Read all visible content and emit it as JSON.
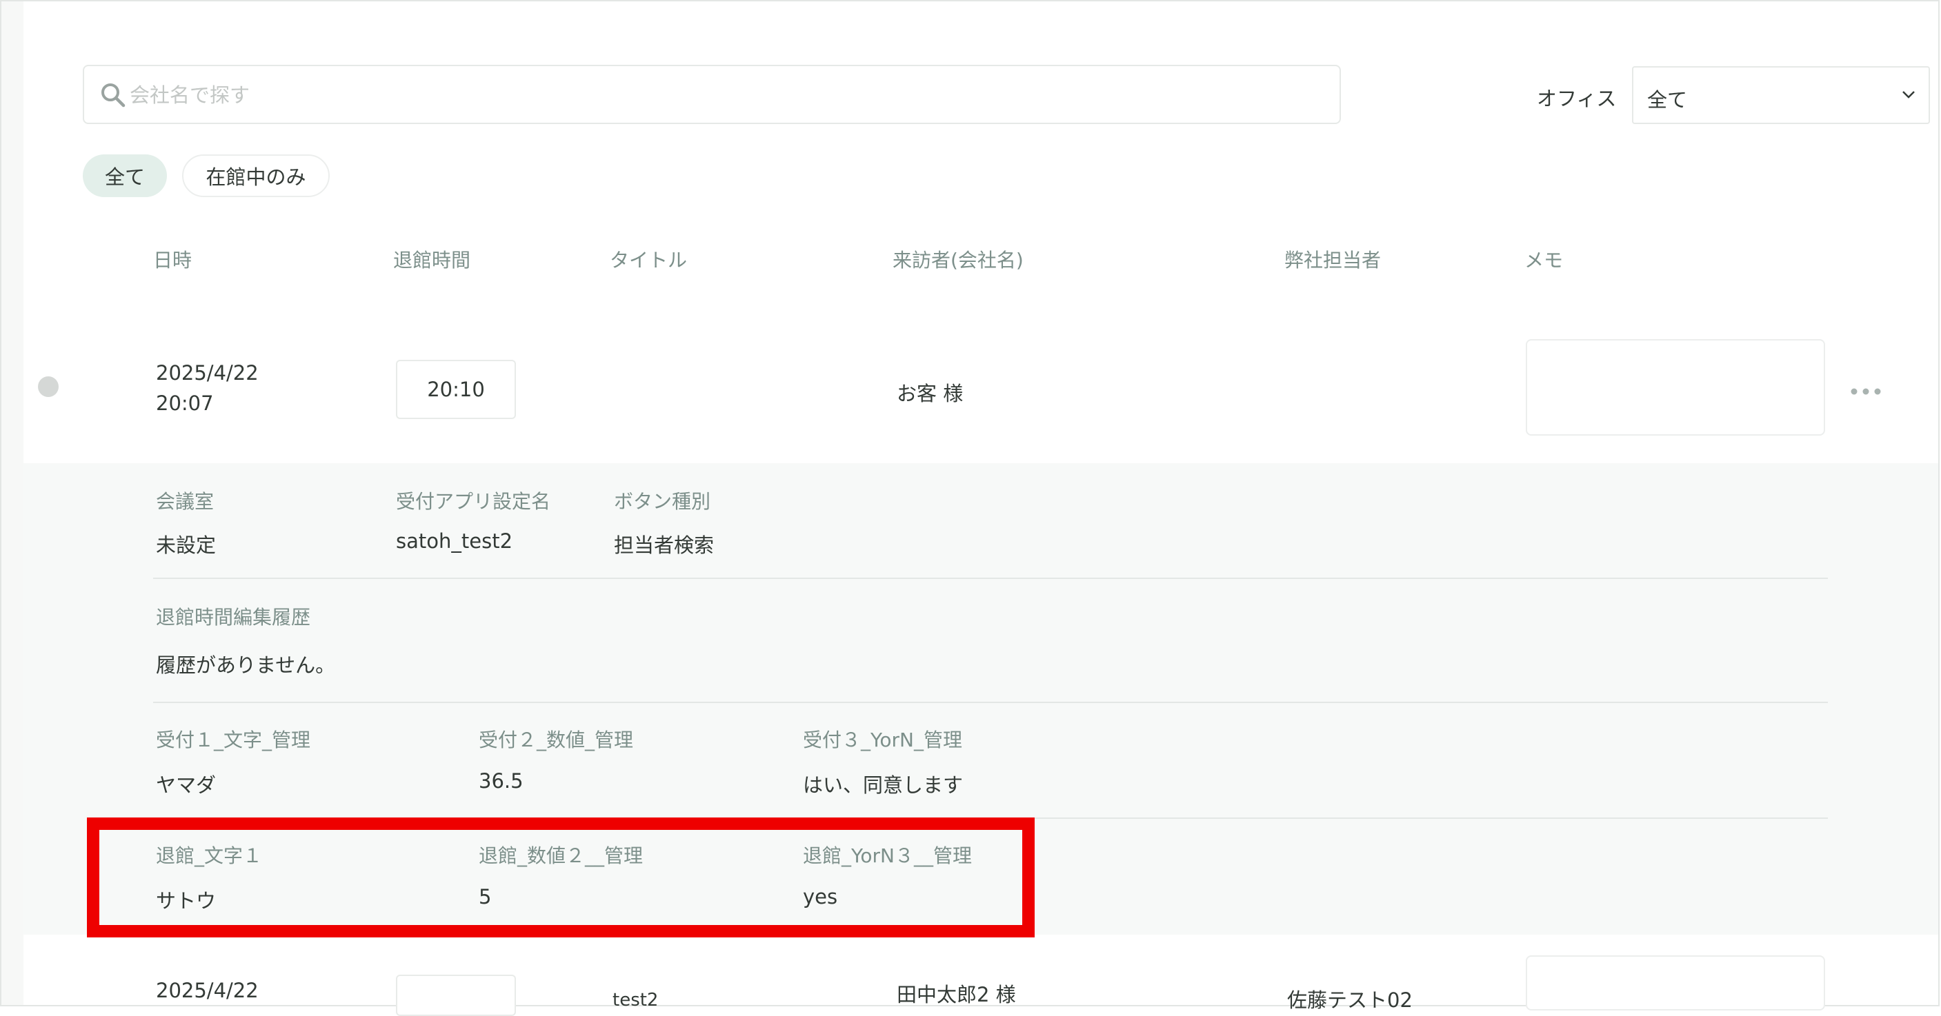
{
  "search": {
    "placeholder": "会社名で探す"
  },
  "office": {
    "label": "オフィス",
    "selected": "全て"
  },
  "filters": {
    "all": "全て",
    "in_house": "在館中のみ"
  },
  "columns": [
    "日時",
    "退館時間",
    "タイトル",
    "来訪者(会社名)",
    "弊社担当者",
    "メモ"
  ],
  "rows": [
    {
      "date": "2025/4/22",
      "time": "20:07",
      "checkout_time": "20:10",
      "title": "",
      "visitor": "お客 様",
      "staff": "",
      "detail": {
        "meeting_room_label": "会議室",
        "meeting_room_value": "未設定",
        "app_setting_label": "受付アプリ設定名",
        "app_setting_value": "satoh_test2",
        "button_type_label": "ボタン種別",
        "button_type_value": "担当者検索",
        "history_label": "退館時間編集履歴",
        "history_value": "履歴がありません。",
        "reception_fields": [
          {
            "label": "受付１_文字_管理",
            "value": "ヤマダ"
          },
          {
            "label": "受付２_数値_管理",
            "value": "36.5"
          },
          {
            "label": "受付３_YorN_管理",
            "value": "はい、同意します"
          }
        ],
        "checkout_fields": [
          {
            "label": "退館_文字１",
            "value": "サトウ"
          },
          {
            "label": "退館_数値２__管理",
            "value": "5"
          },
          {
            "label": "退館_YorN３__管理",
            "value": "yes"
          }
        ]
      }
    },
    {
      "date": "2025/4/22",
      "title": "test2",
      "visitor": "田中太郎2 様",
      "staff": "佐藤テスト02"
    }
  ],
  "colors": {
    "highlight": "#ee0000",
    "label": "#7c8f8a",
    "chip_active": "#e3efea"
  }
}
